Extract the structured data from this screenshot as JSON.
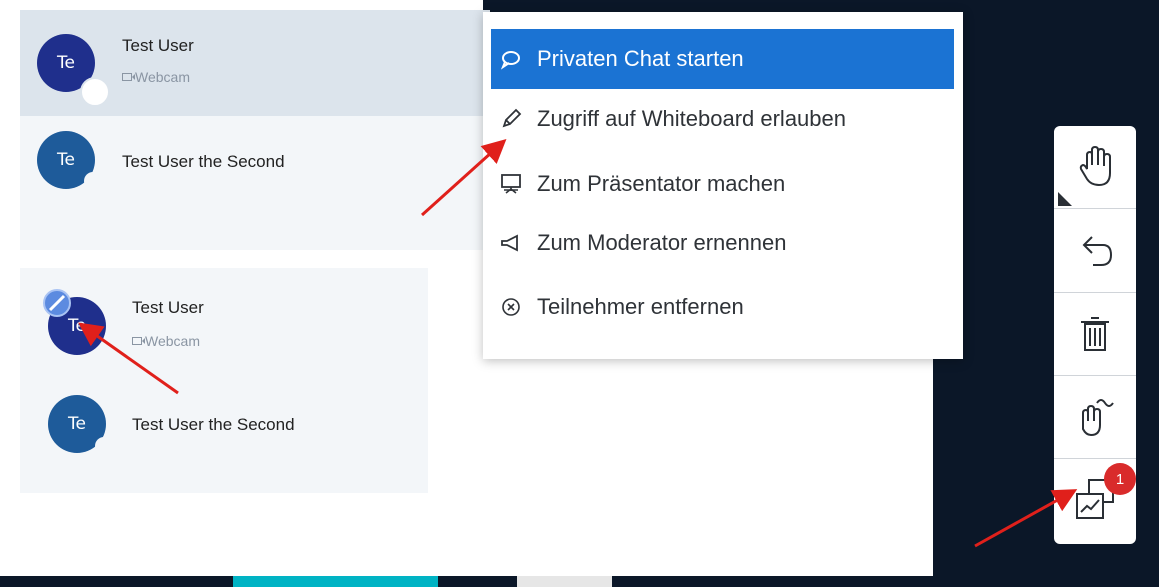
{
  "users_top": [
    {
      "initials": "Te",
      "name": "Test User",
      "sub": "Webcam"
    },
    {
      "initials": "Te",
      "name": "Test User the Second"
    }
  ],
  "users_bottom": [
    {
      "initials": "Te",
      "name": "Test User",
      "sub": "Webcam"
    },
    {
      "initials": "Te",
      "name": "Test User the Second"
    }
  ],
  "context_menu": {
    "items": [
      {
        "label": "Privaten Chat starten",
        "icon": "chat-bubble-icon",
        "active": true
      },
      {
        "label": "Zugriff auf Whiteboard erlauben",
        "icon": "pencil-icon"
      },
      {
        "label": "Zum Präsentator machen",
        "icon": "presentation-screen-icon"
      },
      {
        "label": "Zum Moderator ernennen",
        "icon": "megaphone-icon"
      },
      {
        "label": "Teilnehmer entfernen",
        "icon": "circle-x-icon"
      }
    ]
  },
  "toolbar": {
    "tools": [
      "hand-tool-icon",
      "undo-icon",
      "trash-icon",
      "multi-user-hand-icon",
      "presentation-windows-icon"
    ],
    "badge_count": "1"
  },
  "colors": {
    "accent": "#1b73d3",
    "dark_bg": "#0b1728",
    "avatar_navy": "#1f2f8c",
    "avatar_blue": "#1e5b9a",
    "badge_red": "#d92b2b",
    "arrow_red": "#e0201b"
  }
}
